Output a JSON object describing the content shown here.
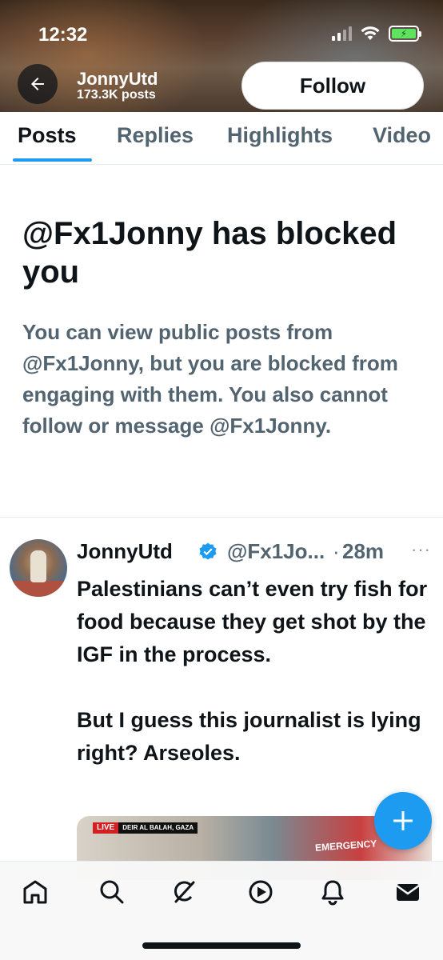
{
  "status_bar": {
    "time": "12:32"
  },
  "header": {
    "name": "JonnyUtd",
    "posts_count": "173.3K posts",
    "follow_label": "Follow"
  },
  "tabs": [
    {
      "label": "Posts",
      "active": true
    },
    {
      "label": "Replies",
      "active": false
    },
    {
      "label": "Highlights",
      "active": false
    },
    {
      "label": "Video",
      "active": false
    }
  ],
  "blocked": {
    "title": "@Fx1Jonny has blocked you",
    "description": "You can view public posts from @Fx1Jonny, but you are blocked from engaging with them. You also cannot follow or message @Fx1Jonny."
  },
  "post": {
    "author_name": "JonnyUtd",
    "handle": "@Fx1Jo...",
    "separator": "·",
    "time": "28m",
    "more": "···",
    "text": "Palestinians can’t even try fish for food because they get shot by the IGF in the process.\n\nBut I guess this journalist is lying right? Arseoles.",
    "media": {
      "live_label": "LIVE",
      "location": "DEIR AL BALAH, GAZA",
      "sign_text": "EMERGENCY"
    }
  },
  "fab_icon": "plus-icon",
  "bottom_nav": [
    {
      "icon": "home-icon"
    },
    {
      "icon": "search-icon"
    },
    {
      "icon": "grok-icon"
    },
    {
      "icon": "video-play-icon"
    },
    {
      "icon": "bell-icon"
    },
    {
      "icon": "mail-icon"
    }
  ],
  "colors": {
    "accent": "#1d9bf0",
    "text_primary": "#0f1419",
    "text_secondary": "#536471"
  }
}
